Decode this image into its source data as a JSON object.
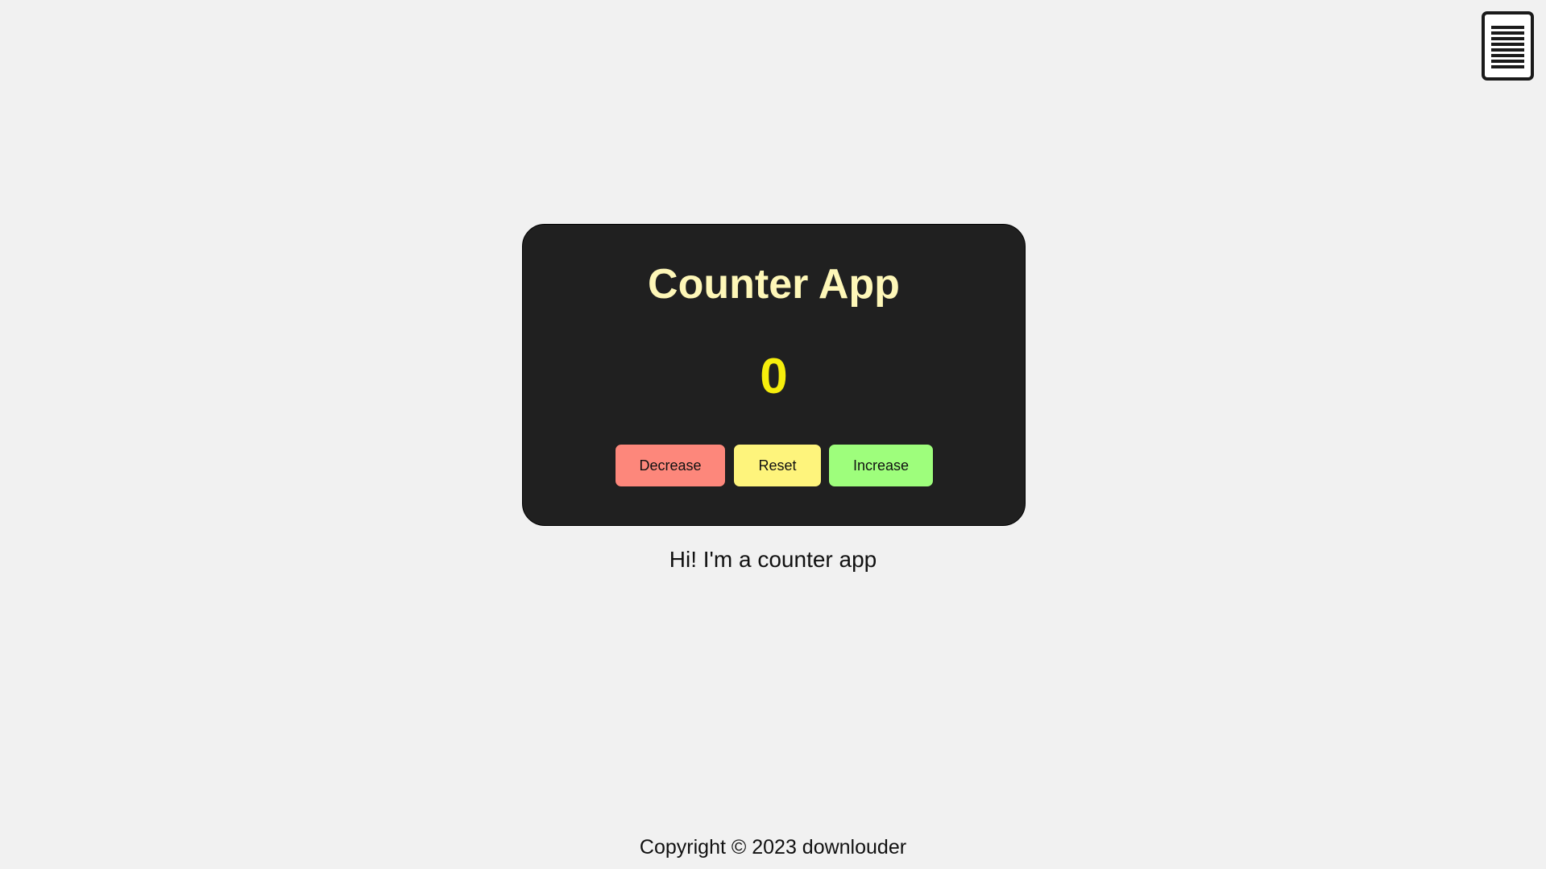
{
  "header": {
    "menu_icon": "document-lines-icon"
  },
  "counter": {
    "title": "Counter App",
    "value": "0",
    "buttons": {
      "decrease_label": "Decrease",
      "reset_label": "Reset",
      "increase_label": "Increase"
    }
  },
  "tagline": "Hi! I'm a counter app",
  "footer": {
    "copyright": "Copyright © 2023 downlouder"
  },
  "colors": {
    "background": "#f1f1f1",
    "card": "#202020",
    "title": "#fef7b8",
    "counter_value": "#f6ee0c",
    "decrease": "#fd877b",
    "reset": "#fef47c",
    "increase": "#9efe7c"
  }
}
